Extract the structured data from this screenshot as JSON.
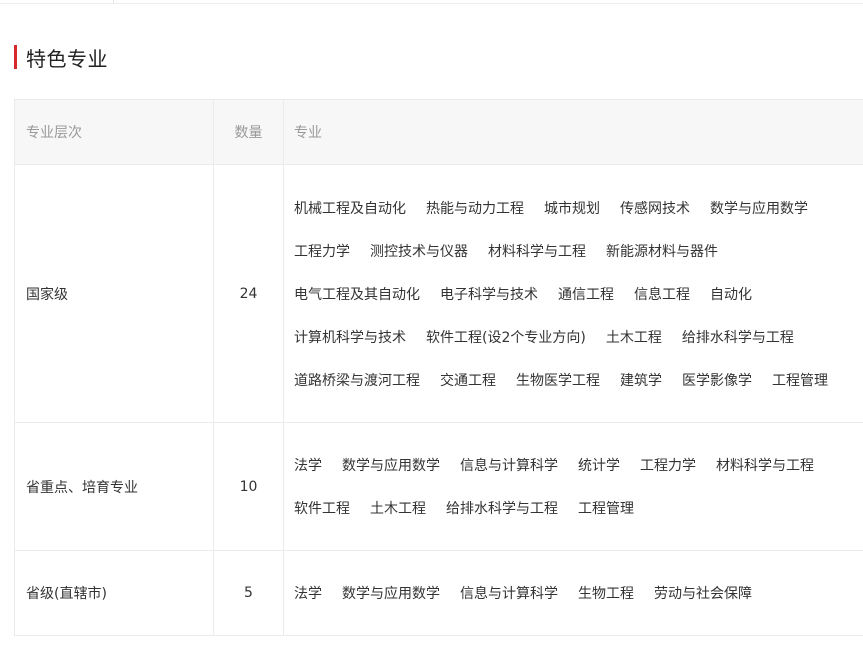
{
  "section": {
    "title": "特色专业"
  },
  "table": {
    "headers": [
      "专业层次",
      "数量",
      "专业"
    ],
    "rows": [
      {
        "level": "国家级",
        "count": "24",
        "major_lines": [
          [
            "机械工程及自动化",
            "热能与动力工程",
            "城市规划",
            "传感网技术",
            "数学与应用数学"
          ],
          [
            "工程力学",
            "测控技术与仪器",
            "材料科学与工程",
            "新能源材料与器件"
          ],
          [
            "电气工程及其自动化",
            "电子科学与技术",
            "通信工程",
            "信息工程",
            "自动化"
          ],
          [
            "计算机科学与技术",
            "软件工程(设2个专业方向)",
            "土木工程",
            "给排水科学与工程"
          ],
          [
            "道路桥梁与渡河工程",
            "交通工程",
            "生物医学工程",
            "建筑学",
            "医学影像学",
            "工程管理"
          ]
        ]
      },
      {
        "level": "省重点、培育专业",
        "count": "10",
        "major_lines": [
          [
            "法学",
            "数学与应用数学",
            "信息与计算科学",
            "统计学",
            "工程力学",
            "材料科学与工程"
          ],
          [
            "软件工程",
            "土木工程",
            "给排水科学与工程",
            "工程管理"
          ]
        ]
      },
      {
        "level": "省级(直辖市)",
        "count": "5",
        "major_lines": [
          [
            "法学",
            "数学与应用数学",
            "信息与计算科学",
            "生物工程",
            "劳动与社会保障"
          ]
        ]
      }
    ]
  },
  "colors": {
    "accent": "#d7282a",
    "header_bg": "#f7f7f7",
    "border": "#ebebeb"
  }
}
